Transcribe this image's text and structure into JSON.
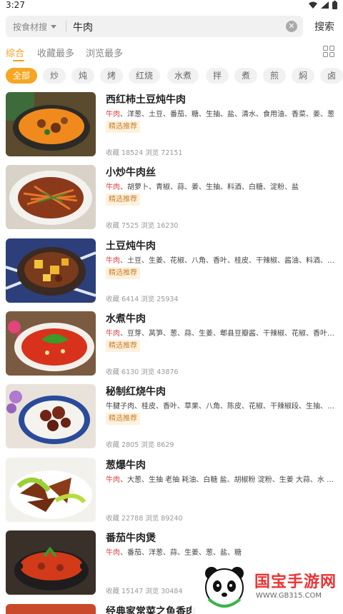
{
  "status_bar": {
    "time": "3:27",
    "icons": [
      "wifi-icon",
      "signal-icon",
      "battery-icon"
    ]
  },
  "search": {
    "filter_label": "按食材搜",
    "value": "牛肉",
    "button_label": "搜索"
  },
  "sort_tabs": [
    {
      "label": "综合",
      "active": true
    },
    {
      "label": "收藏最多",
      "active": false
    },
    {
      "label": "浏览最多",
      "active": false
    }
  ],
  "method_chips": [
    "全部",
    "炒",
    "炖",
    "烤",
    "红烧",
    "水煮",
    "拌",
    "煮",
    "煎",
    "焖",
    "卤"
  ],
  "colors": {
    "accent": "#f5a623",
    "highlight": "#e23b3b",
    "badge_bg": "#fdf1df",
    "badge_text": "#c9822a"
  },
  "recipes": [
    {
      "title": "西红柿土豆炖牛肉",
      "ing_main": "牛肉",
      "ing_rest": "、洋葱、土豆、番茄、糖、生抽、盐、清水、食用油、香菜、姜、葱",
      "badge": "精选推荐",
      "stats": "收藏 18524 浏览 72151",
      "img": "stew"
    },
    {
      "title": "小炒牛肉丝",
      "ing_main": "牛肉",
      "ing_rest": "、胡萝卜、青椒、蒜、姜、生抽、料酒、白糖、淀粉、盐",
      "badge": "精选推荐",
      "stats": "收藏 7525 浏览 16230",
      "img": "stirfry"
    },
    {
      "title": "土豆炖牛肉",
      "ing_main": "牛肉",
      "ing_rest": "、土豆、生姜、花椒、八角、香叶、桂皮、干辣椒、酱油、料酒、盐...",
      "badge": "精选推荐",
      "stats": "收藏 6414 浏览 25934",
      "img": "potato"
    },
    {
      "title": "水煮牛肉",
      "ing_main": "牛肉",
      "ing_rest": "、豆芽、莴笋、葱、蒜、生姜、郫县豆瓣酱、干辣椒、花椒、香叶、...",
      "badge": "精选推荐",
      "stats": "收藏 6130 浏览 43876",
      "img": "boiled"
    },
    {
      "title": "秘制红烧牛肉",
      "ing_main": "",
      "ing_rest": "牛腱子肉、桂皮、香叶、草果、八角、陈皮、花椒、干辣椒段、生抽、老...",
      "badge": "精选推荐",
      "stats": "收藏 2805 浏览 8629",
      "img": "braised"
    },
    {
      "title": "葱爆牛肉",
      "ing_main": "牛肉",
      "ing_rest": "、大葱、生抽 老抽 耗油、白糖 盐、胡椒粉 淀粉、生姜 大蒜、水 食用...",
      "badge": "",
      "stats": "收藏 22788 浏览 89240",
      "img": "scallion"
    },
    {
      "title": "番茄牛肉煲",
      "ing_main": "牛肉",
      "ing_rest": "、番茄、洋葱、蒜、生姜、葱、盐、糖",
      "badge": "",
      "stats": "收藏 15147 浏览 30484",
      "img": "tomato"
    },
    {
      "title": "经典家常菜之鱼香肉",
      "ing_main": "",
      "ing_rest": "",
      "badge": "",
      "stats": "",
      "img": "fish"
    }
  ],
  "watermark": {
    "brand": "国宝手游网",
    "url": "WWW.GB315.COM"
  }
}
